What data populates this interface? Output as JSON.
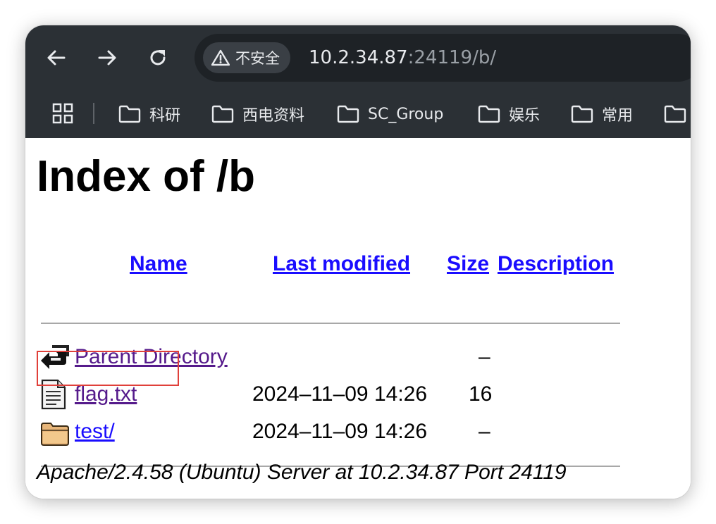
{
  "toolbar": {
    "back_icon": "arrow-left-icon",
    "forward_icon": "arrow-right-icon",
    "reload_icon": "reload-icon",
    "security_label": "不安全",
    "security_icon": "warning-triangle-icon",
    "url_host": "10.2.34.87",
    "url_rest": ":24119/b/"
  },
  "bookmarks": {
    "apps_icon": "apps-grid-icon",
    "items": [
      {
        "label": "科研"
      },
      {
        "label": "西电资料"
      },
      {
        "label": "SC_Group"
      },
      {
        "label": "娱乐"
      },
      {
        "label": "常用"
      },
      {
        "label": ""
      }
    ]
  },
  "page": {
    "title": "Index of /b",
    "columns": {
      "name": "Name",
      "last_modified": "Last modified",
      "size": "Size",
      "description": "Description"
    },
    "rows": [
      {
        "icon": "parent-directory-icon",
        "name": "Parent Directory",
        "modified": "",
        "size": "–"
      },
      {
        "icon": "text-file-icon",
        "name": "flag.txt",
        "modified": "2024–11–09 14:26",
        "size": "16"
      },
      {
        "icon": "folder-icon",
        "name": "test/",
        "modified": "2024–11–09 14:26",
        "size": "–"
      }
    ],
    "footer": "Apache/2.4.58 (Ubuntu) Server at 10.2.34.87 Port 24119"
  },
  "colors": {
    "chrome_bg": "#2b3035",
    "link_unvisited": "#1a0dff",
    "link_visited": "#551a8b",
    "highlight_border": "#e0403a"
  }
}
